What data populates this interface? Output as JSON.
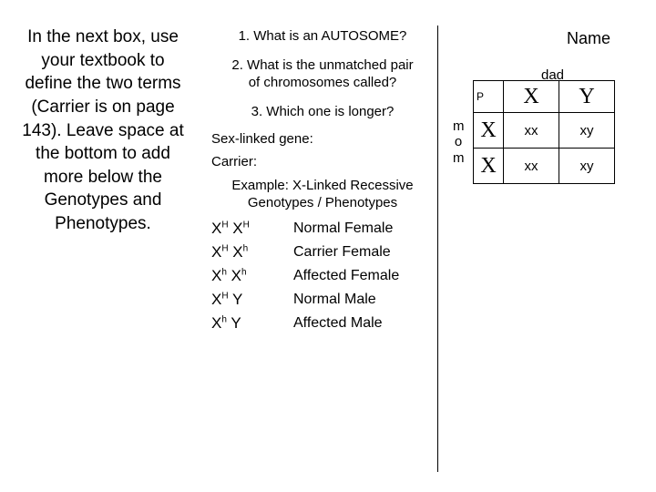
{
  "instructions": "In the next box, use your textbook to define the two terms (Carrier is on page 143). Leave space at the bottom to add more below the Genotypes and Phenotypes.",
  "questions": {
    "q1": "1.  What is an AUTOSOME?",
    "q2": "2.  What is the unmatched pair of chromosomes called?",
    "q3": "3.  Which one is longer?"
  },
  "defs": {
    "sexlinked": "Sex-linked gene:",
    "carrier": "Carrier:"
  },
  "example": {
    "line1": "Example: X-Linked Recessive",
    "line2": "Genotypes / Phenotypes"
  },
  "gp": [
    {
      "g_parts": [
        "X",
        "H",
        " X",
        "H"
      ],
      "p": "Normal Female"
    },
    {
      "g_parts": [
        "X",
        "H",
        " X",
        "h"
      ],
      "p": "Carrier Female"
    },
    {
      "g_parts": [
        "X",
        "h",
        " X",
        "h"
      ],
      "p": "Affected Female"
    },
    {
      "g_parts": [
        "X",
        "H",
        " Y",
        ""
      ],
      "p": "Normal Male"
    },
    {
      "g_parts": [
        "X",
        "h",
        " Y",
        ""
      ],
      "p": "Affected Male"
    }
  ],
  "name_label": "Name",
  "punnett": {
    "dad": "dad",
    "mom": "mom",
    "p_label": "P",
    "col1": "X",
    "col2": "Y",
    "row1": "X",
    "row2": "X",
    "c11": "xx",
    "c12": "xy",
    "c21": "xx",
    "c22": "xy"
  }
}
